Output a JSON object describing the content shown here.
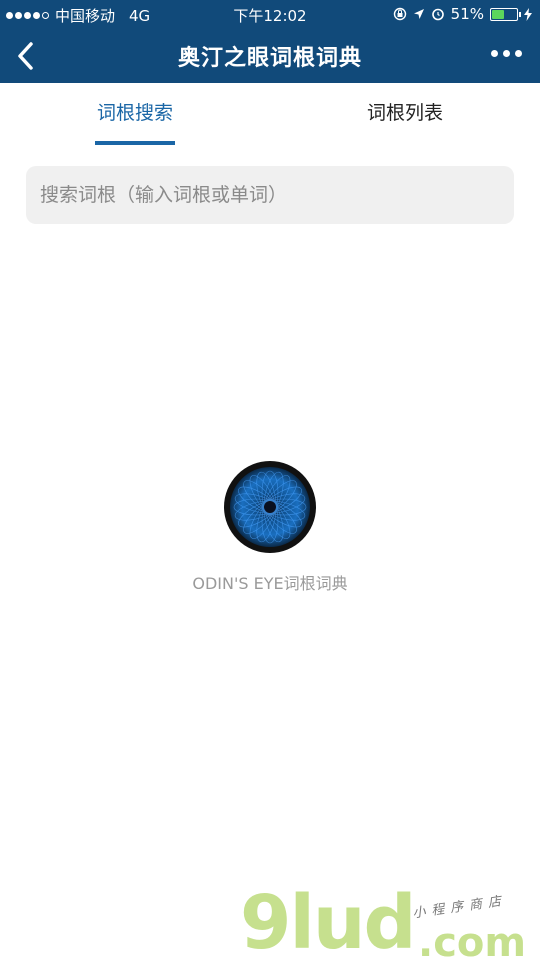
{
  "status_bar": {
    "carrier": "中国移动",
    "network": "4G",
    "time": "下午12:02",
    "battery": "51%",
    "battery_level": 0.51,
    "icons": [
      "lock-rotation-icon",
      "location-arrow-icon",
      "alarm-icon",
      "battery-icon",
      "charging-icon"
    ]
  },
  "nav": {
    "title": "奥汀之眼词根词典",
    "back_icon": "chevron-left-icon",
    "more_icon": "more-dots-icon"
  },
  "tabs": [
    {
      "label": "词根搜索",
      "active": true
    },
    {
      "label": "词根列表",
      "active": false
    }
  ],
  "search": {
    "placeholder": "搜索词根（输入词根或单词）",
    "value": ""
  },
  "empty_state": {
    "caption": "ODIN'S EYE词根词典"
  },
  "watermark": {
    "main": "9lud",
    "domain": ".com",
    "tagline": "小程序商店"
  },
  "colors": {
    "header": "#114a7a",
    "accent": "#1a66a6",
    "search_bg": "#f0f0f0",
    "battery_fill": "#5cd65c"
  }
}
